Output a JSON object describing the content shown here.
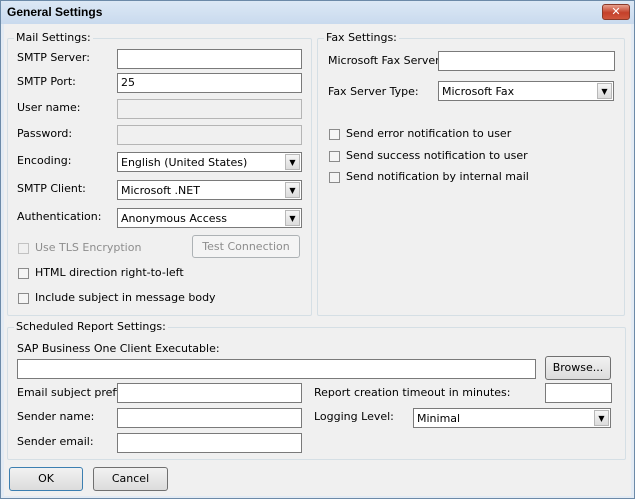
{
  "window": {
    "title": "General Settings",
    "close_glyph": "✕"
  },
  "mail": {
    "legend": "Mail Settings:",
    "smtp_server_label": "SMTP Server:",
    "smtp_server_value": "",
    "smtp_port_label": "SMTP Port:",
    "smtp_port_value": "25",
    "user_name_label": "User name:",
    "user_name_value": "",
    "password_label": "Password:",
    "password_value": "",
    "encoding_label": "Encoding:",
    "encoding_value": "English (United States)",
    "smtp_client_label": "SMTP Client:",
    "smtp_client_value": "Microsoft .NET",
    "authentication_label": "Authentication:",
    "authentication_value": "Anonymous Access",
    "use_tls_label": "Use TLS Encryption",
    "use_tls_checked": false,
    "test_connection_label": "Test Connection",
    "html_rtl_label": "HTML direction right-to-left",
    "html_rtl_checked": false,
    "include_subject_label": "Include subject in message body",
    "include_subject_checked": false
  },
  "fax": {
    "legend": "Fax Settings:",
    "server_label": "Microsoft Fax Server:",
    "server_value": "",
    "type_label": "Fax Server Type:",
    "type_value": "Microsoft Fax",
    "send_error_label": "Send error notification to user",
    "send_success_label": "Send success notification to user",
    "send_internal_label": "Send notification by internal mail"
  },
  "scheduled": {
    "legend": "Scheduled Report Settings:",
    "client_exec_label": "SAP Business One Client Executable:",
    "client_exec_value": "",
    "browse_label": "Browse...",
    "email_prefix_label": "Email subject prefix:",
    "email_prefix_value": "",
    "sender_name_label": "Sender name:",
    "sender_name_value": "",
    "sender_email_label": "Sender email:",
    "sender_email_value": "",
    "timeout_label": "Report creation timeout in minutes:",
    "timeout_value": "",
    "logging_label": "Logging Level:",
    "logging_value": "Minimal"
  },
  "footer": {
    "ok_label": "OK",
    "cancel_label": "Cancel"
  },
  "icons": {
    "dropdown_arrow": "▼"
  }
}
